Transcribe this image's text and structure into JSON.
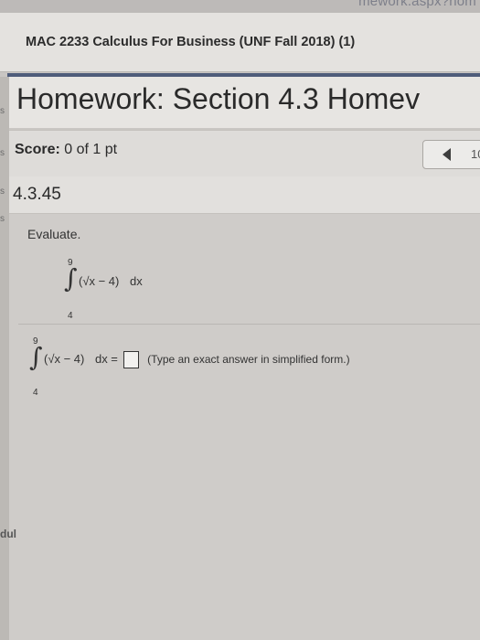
{
  "browser": {
    "url_fragment": "mework.aspx?hom"
  },
  "course": {
    "title": "MAC 2233 Calculus For Business (UNF Fall 2018) (1)"
  },
  "homework": {
    "title": "Homework: Section 4.3 Homev"
  },
  "score": {
    "label": "Score:",
    "value": "0 of 1 pt"
  },
  "nav": {
    "prev_icon": "left-triangle-icon",
    "count": "10"
  },
  "question": {
    "number": "4.3.45",
    "prompt": "Evaluate.",
    "integral": {
      "upper": "9",
      "lower": "4",
      "integrand": "(√x − 4)",
      "dx": "dx"
    },
    "answer": {
      "lhs_eq": "dx =",
      "value": "",
      "hint": "(Type an exact answer in simplified form.)"
    }
  },
  "left_edge": {
    "mark_1": "s",
    "mark_2": "s",
    "mark_3": "s",
    "mark_4": "s"
  },
  "left_stub": "dul"
}
